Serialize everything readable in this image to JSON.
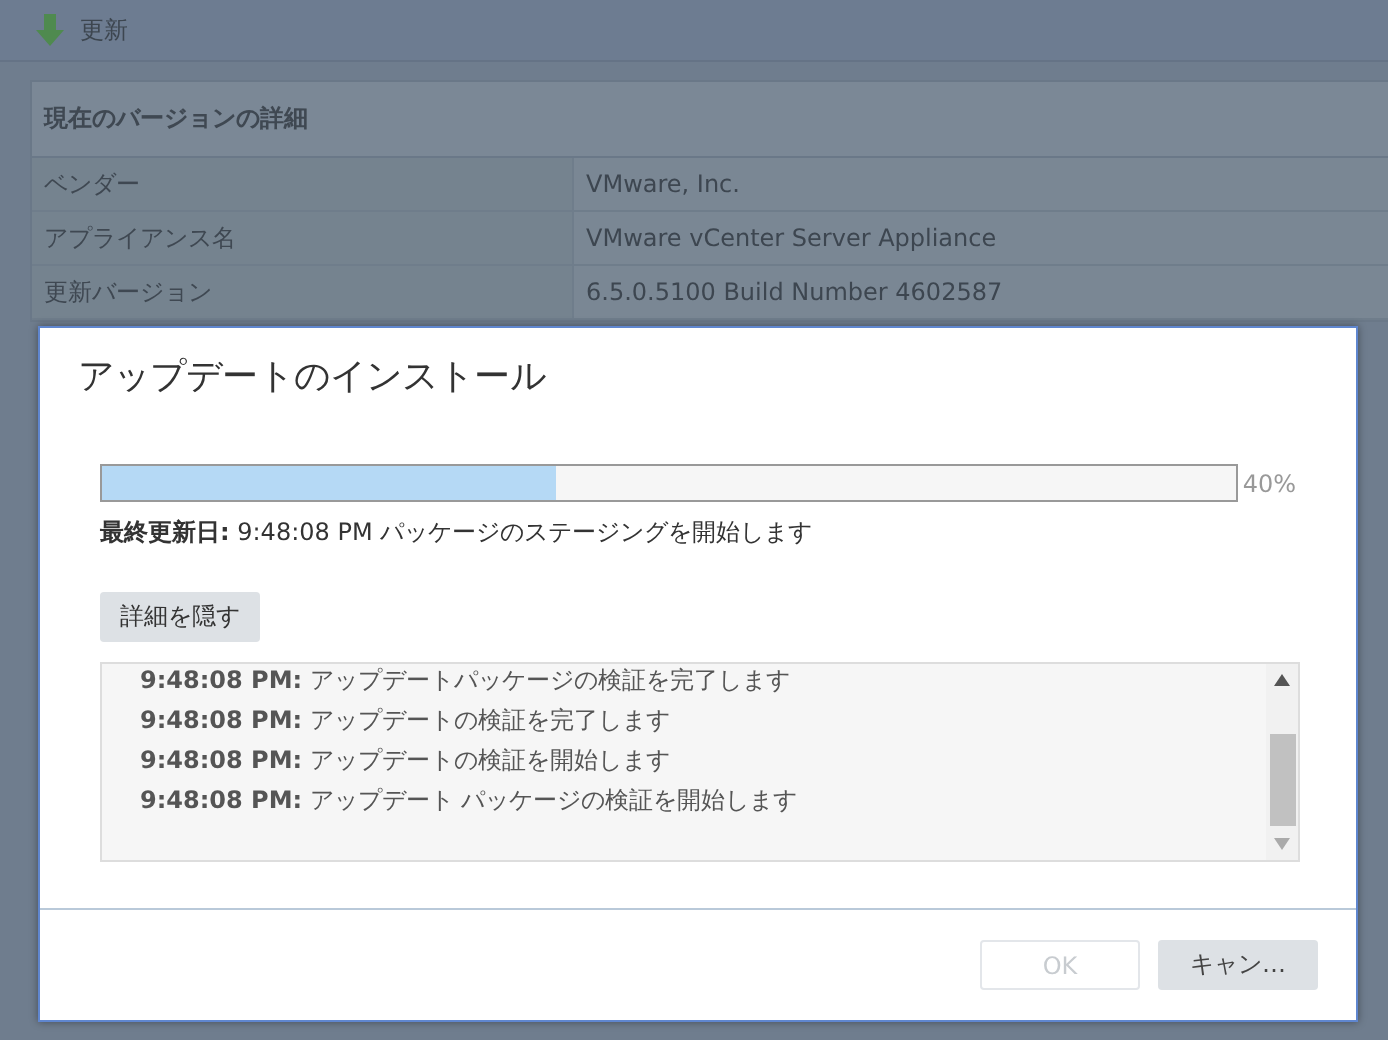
{
  "page": {
    "header": {
      "title": "更新"
    },
    "details": {
      "title": "現在のバージョンの詳細",
      "rows": [
        {
          "label": "ベンダー",
          "value": "VMware, Inc."
        },
        {
          "label": "アプライアンス名",
          "value": "VMware vCenter Server Appliance"
        },
        {
          "label": "更新バージョン",
          "value": "6.5.0.5100 Build Number 4602587"
        }
      ]
    }
  },
  "dialog": {
    "title": "アップデートのインストール",
    "progress": {
      "level": 0.4,
      "reading": "40%"
    },
    "status": "**最終更新日:** 9:48:08 PM パッケージのステージングを開始します",
    "toggle_button": "詳細を隠す",
    "log": [
      "**9:48:08 PM:** アップデートパッケージの検証を完了します",
      "**9:48:08 PM:** アップデートの検証を完了します",
      "**9:48:08 PM:** アップデートの検証を開始します",
      "**9:48:08 PM:** アップデート パッケージの検証を開始します"
    ],
    "buttons": [
      {
        "label": "OK",
        "disabled": true
      },
      {
        "label": "キャン…",
        "disabled": false
      }
    ]
  }
}
